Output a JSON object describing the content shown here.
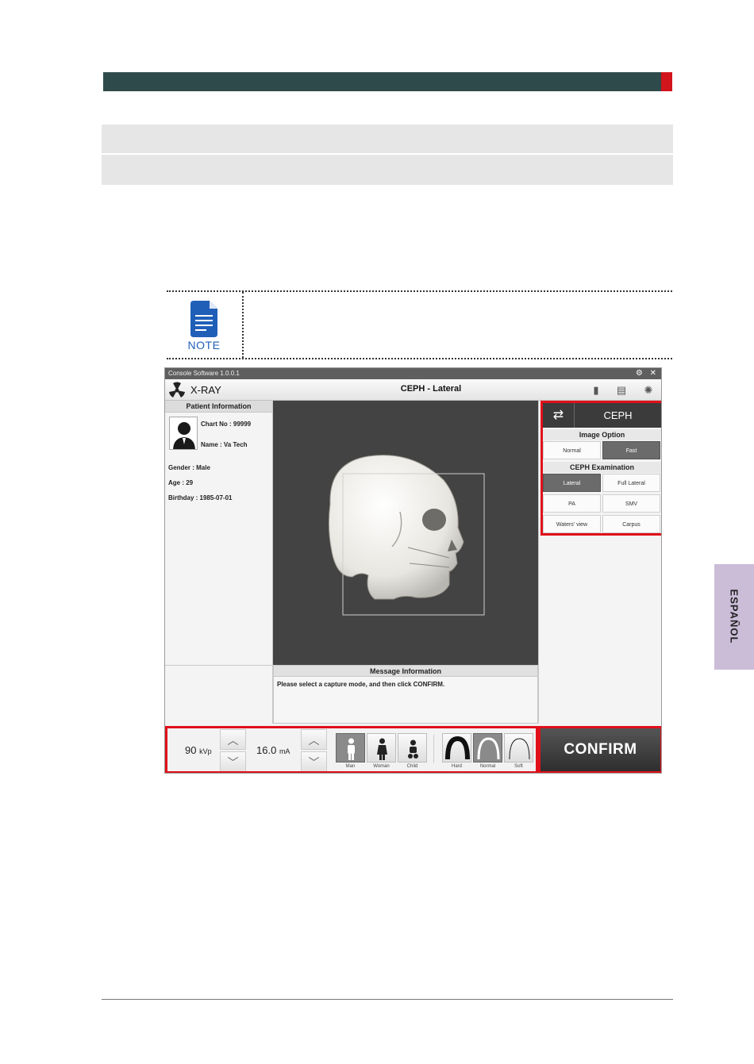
{
  "note": {
    "label": "NOTE"
  },
  "side_tab": {
    "label": "ESPAÑOL"
  },
  "app": {
    "title": "Console Software  1.0.0.1",
    "brand": "X-RAY",
    "view_title": "CEPH - Lateral",
    "patient": {
      "header": "Patient Information",
      "chart_no": "Chart No : 99999",
      "name": "Name : Va Tech",
      "gender": "Gender : Male",
      "age": "Age : 29",
      "birthday": "Birthday : 1985-07-01"
    },
    "message": {
      "header": "Message Information",
      "text": "Please select a capture mode, and then click CONFIRM."
    },
    "ceph": {
      "mode_label": "CEPH",
      "image_option_header": "Image Option",
      "image_options": [
        "Normal",
        "Fast"
      ],
      "examination_header": "CEPH Examination",
      "examinations": [
        "Lateral",
        "Full Lateral",
        "PA",
        "SMV",
        "Waters' view",
        "Carpus"
      ]
    },
    "exposure": {
      "kvp_value": "90",
      "kvp_unit": "kVp",
      "ma_value": "16.0",
      "ma_unit": "mA"
    },
    "patient_types": [
      "Man",
      "Woman",
      "Child"
    ],
    "density": [
      "Hard",
      "Normal",
      "Soft"
    ],
    "confirm_label": "CONFIRM"
  }
}
